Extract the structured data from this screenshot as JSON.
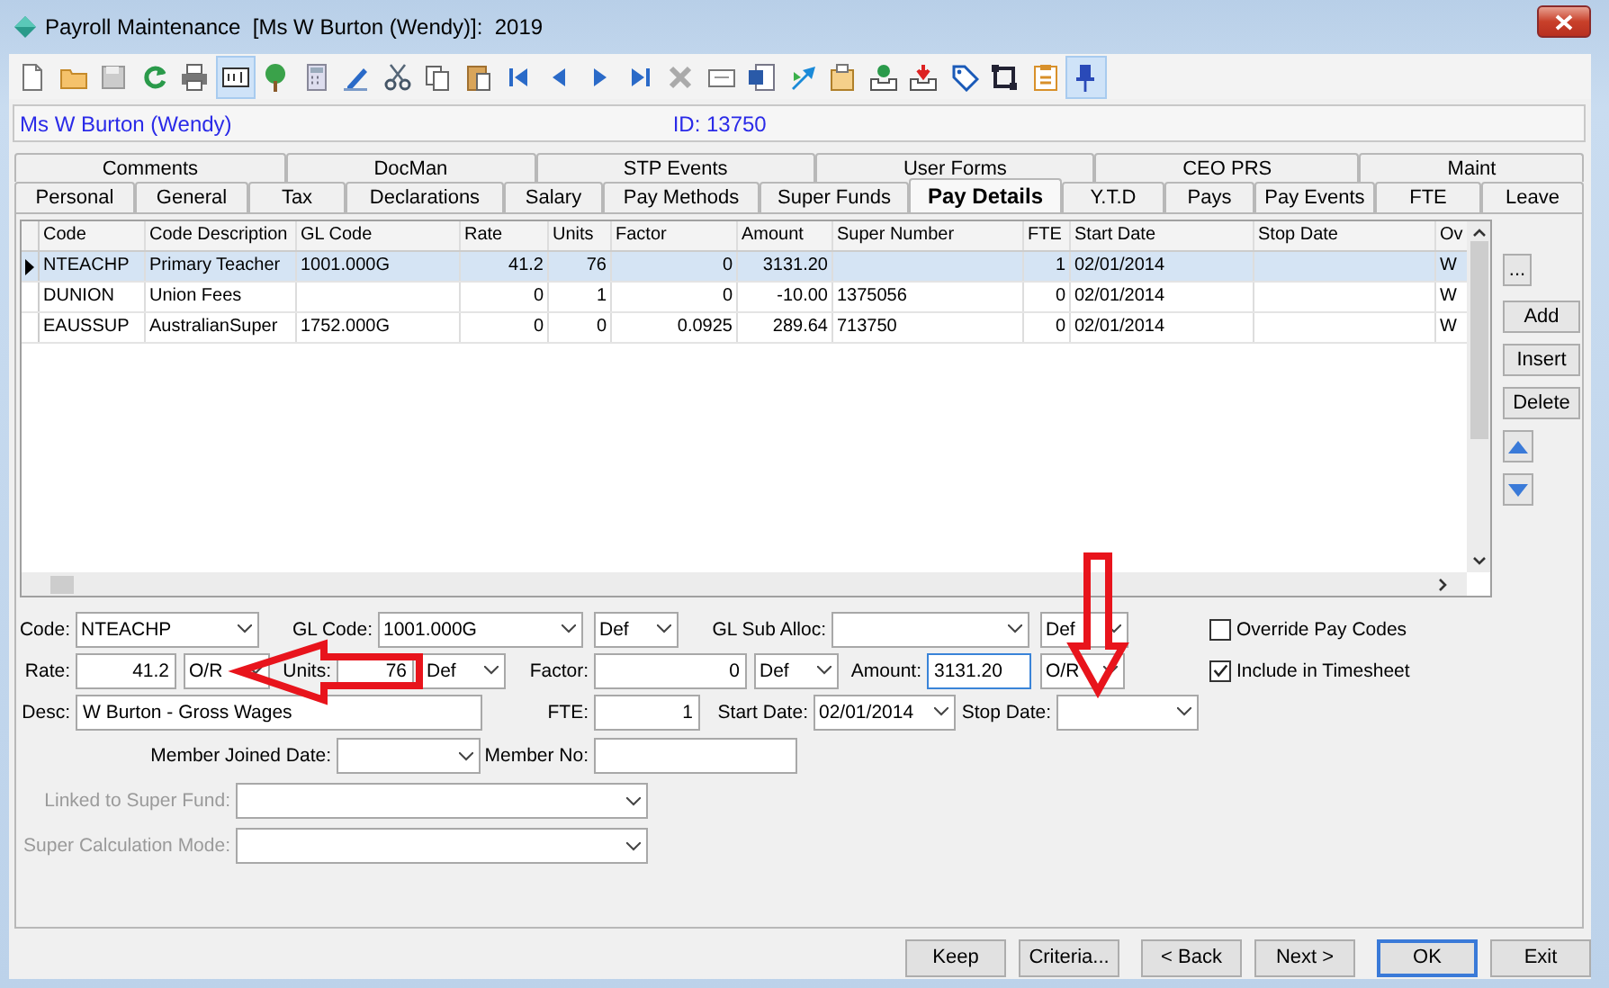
{
  "window": {
    "title": "Payroll Maintenance  [Ms W Burton (Wendy)]:  2019"
  },
  "toolbar": [
    {
      "kind": "new",
      "selected": false
    },
    {
      "kind": "open",
      "selected": false
    },
    {
      "kind": "save",
      "selected": false
    },
    {
      "kind": "refresh",
      "selected": false
    },
    {
      "kind": "print",
      "selected": false
    },
    {
      "kind": "textbox",
      "selected": true
    },
    {
      "kind": "tree",
      "selected": false
    },
    {
      "kind": "calculator",
      "selected": false
    },
    {
      "kind": "spell",
      "selected": false
    },
    {
      "kind": "cut",
      "selected": false
    },
    {
      "kind": "copy",
      "selected": false
    },
    {
      "kind": "paste",
      "selected": false
    },
    {
      "kind": "first",
      "selected": false
    },
    {
      "kind": "prev",
      "selected": false
    },
    {
      "kind": "next",
      "selected": false
    },
    {
      "kind": "last",
      "selected": false
    },
    {
      "kind": "delete",
      "selected": false
    },
    {
      "kind": "card",
      "selected": false
    },
    {
      "kind": "word",
      "selected": false
    },
    {
      "kind": "shoot",
      "selected": false
    },
    {
      "kind": "foldercard",
      "selected": false
    },
    {
      "kind": "traycheck",
      "selected": false
    },
    {
      "kind": "traydown",
      "selected": false
    },
    {
      "kind": "tag",
      "selected": false
    },
    {
      "kind": "frame",
      "selected": false
    },
    {
      "kind": "checklist",
      "selected": false
    },
    {
      "kind": "pin",
      "selected": true
    }
  ],
  "employee": {
    "name": "Ms W Burton (Wendy)",
    "id": "ID: 13750"
  },
  "tabs_back": [
    {
      "label": "Comments",
      "selected": false
    },
    {
      "label": "DocMan",
      "selected": false
    },
    {
      "label": "STP Events",
      "selected": false
    },
    {
      "label": "User Forms",
      "selected": false
    },
    {
      "label": "CEO PRS",
      "selected": false
    },
    {
      "label": "Maint",
      "selected": false
    }
  ],
  "tabs": [
    {
      "label": "Personal",
      "selected": false
    },
    {
      "label": "General",
      "selected": false
    },
    {
      "label": "Tax",
      "selected": false
    },
    {
      "label": "Declarations",
      "selected": false
    },
    {
      "label": "Salary",
      "selected": false
    },
    {
      "label": "Pay Methods",
      "selected": false
    },
    {
      "label": "Super Funds",
      "selected": false
    },
    {
      "label": "Pay Details",
      "selected": true
    },
    {
      "label": "Y.T.D",
      "selected": false
    },
    {
      "label": "Pays",
      "selected": false
    },
    {
      "label": "Pay Events",
      "selected": false
    },
    {
      "label": "FTE",
      "selected": false
    },
    {
      "label": "Leave",
      "selected": false
    }
  ],
  "table": {
    "columns": [
      "Code",
      "Code Description",
      "GL Code",
      "Rate",
      "Units",
      "Factor",
      "Amount",
      "Super Number",
      "FTE",
      "Start Date",
      "Stop Date",
      "Ov"
    ],
    "rows": [
      {
        "selected": true,
        "cells": [
          "NTEACHP",
          "Primary Teacher",
          "1001.000G",
          "41.2",
          "76",
          "0",
          "3131.20",
          null,
          "1",
          "02/01/2014",
          null,
          "W"
        ]
      },
      {
        "selected": false,
        "cells": [
          "DUNION",
          "Union Fees",
          null,
          "0",
          "1",
          "0",
          "-10.00",
          "1375056",
          "0",
          "02/01/2014",
          null,
          "W"
        ]
      },
      {
        "selected": false,
        "cells": [
          "EAUSSUP",
          "AustralianSuper",
          "1752.000G",
          "0",
          "0",
          "0.0925",
          "289.64",
          "713750",
          "0",
          "02/01/2014",
          null,
          "W"
        ]
      }
    ]
  },
  "side_buttons": [
    {
      "kind": "text",
      "label": "..."
    },
    {
      "kind": "text",
      "label": "Add"
    },
    {
      "kind": "text",
      "label": "Insert"
    },
    {
      "kind": "text",
      "label": "Delete"
    },
    {
      "kind": "up"
    },
    {
      "kind": "down"
    }
  ],
  "form": {
    "code": {
      "label": "Code:",
      "value": "NTEACHP"
    },
    "gl_code": {
      "label": "GL Code:",
      "value": "1001.000G",
      "option": "Def"
    },
    "gl_sub_alloc": {
      "label": "GL Sub Alloc:",
      "option": "Def"
    },
    "override": {
      "label": "Override Pay Codes",
      "checked": false
    },
    "rate": {
      "label": "Rate:",
      "value": "41.2",
      "option": "O/R"
    },
    "units": {
      "label": "Units:",
      "value": "76",
      "option": "Def"
    },
    "factor": {
      "label": "Factor:",
      "value": "0",
      "option": "Def"
    },
    "amount": {
      "label": "Amount:",
      "value": "3131.20",
      "option": "O/R",
      "focused": true
    },
    "timesheet": {
      "label": "Include in Timesheet",
      "checked": true
    },
    "desc": {
      "label": "Desc:",
      "value": "W Burton - Gross Wages"
    },
    "fte": {
      "label": "FTE:",
      "value": "1"
    },
    "start_date": {
      "label": "Start Date:",
      "value": "02/01/2014"
    },
    "stop_date": {
      "label": "Stop Date:"
    },
    "member_joined": {
      "label": "Member Joined Date:"
    },
    "member_no": {
      "label": "Member No:"
    },
    "linked_fund": {
      "label": "Linked to Super Fund:",
      "disabled": true
    },
    "calc_mode": {
      "label": "Super Calculation Mode:",
      "disabled": true
    }
  },
  "buttons": [
    {
      "label": "Keep",
      "focused": false
    },
    {
      "label": "Criteria...",
      "focused": false
    },
    {
      "label": "< Back",
      "focused": false
    },
    {
      "label": "Next >",
      "focused": false
    },
    {
      "label": "OK",
      "focused": true
    },
    {
      "label": "Exit",
      "focused": false
    }
  ]
}
